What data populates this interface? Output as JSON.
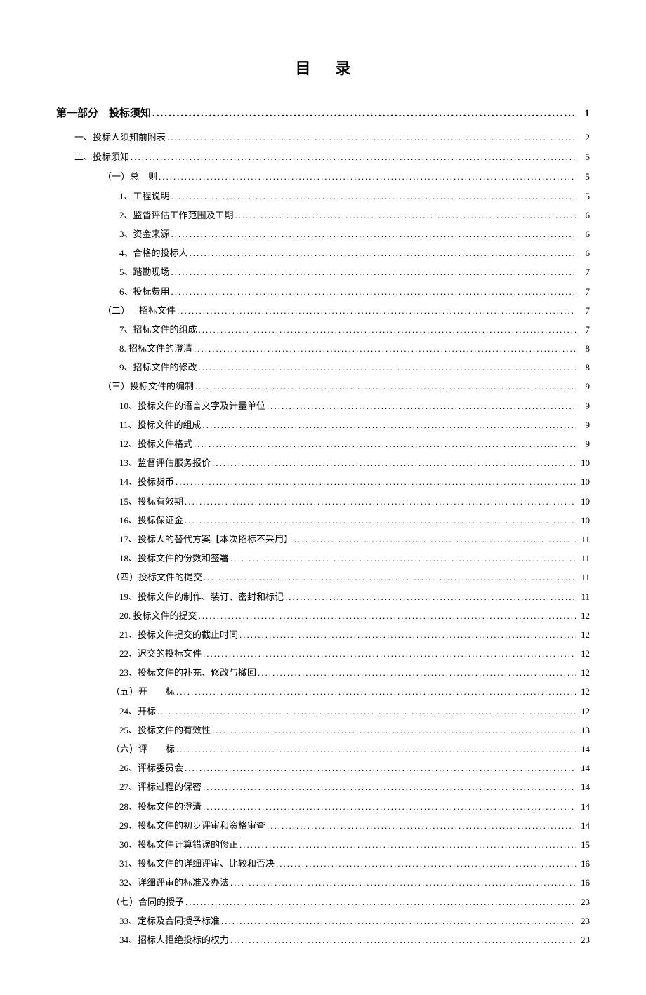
{
  "title": "目录",
  "entries": [
    {
      "level": 0,
      "label": "第一部分 投标须知",
      "page": "1"
    },
    {
      "level": 1,
      "label": "一、投标人须知前附表",
      "page": "2"
    },
    {
      "level": 1,
      "label": "二、投标须知",
      "page": "5"
    },
    {
      "level": 2,
      "label": "（一）总 则",
      "page": "5"
    },
    {
      "level": 3,
      "label": "1、工程说明",
      "page": "5"
    },
    {
      "level": 3,
      "label": "2、监督评估工作范围及工期",
      "page": "6"
    },
    {
      "level": 3,
      "label": "3、资金来源",
      "page": "6"
    },
    {
      "level": 3,
      "label": "4、合格的投标人",
      "page": "6"
    },
    {
      "level": 3,
      "label": "5、踏勘现场",
      "page": "7"
    },
    {
      "level": 3,
      "label": "6、投标费用",
      "page": "7"
    },
    {
      "level": 2,
      "label": "（二） 招标文件",
      "page": "7"
    },
    {
      "level": 3,
      "label": "7、招标文件的组成",
      "page": "7"
    },
    {
      "level": 3,
      "label": "8. 招标文件的澄清",
      "page": "8"
    },
    {
      "level": 3,
      "label": "9、招标文件的修改",
      "page": "8"
    },
    {
      "level": 2,
      "label": "（三）投标文件的编制",
      "page": "9"
    },
    {
      "level": 3,
      "label": "10、投标文件的语言文字及计量单位",
      "page": "9"
    },
    {
      "level": 3,
      "label": "11、投标文件的组成",
      "page": "9"
    },
    {
      "level": 3,
      "label": "12、投标文件格式",
      "page": "9"
    },
    {
      "level": 3,
      "label": "13、监督评估服务报价",
      "page": "10"
    },
    {
      "level": 3,
      "label": "14、投标货币",
      "page": "10"
    },
    {
      "level": 3,
      "label": "15、投标有效期",
      "page": "10"
    },
    {
      "level": 3,
      "label": "16、投标保证金",
      "page": "10"
    },
    {
      "level": 3,
      "label": "17、投标人的替代方案【本次招标不采用】",
      "page": "11"
    },
    {
      "level": 3,
      "label": "18、投标文件的份数和签署",
      "page": "11"
    },
    {
      "level": "3b",
      "label": "（四）投标文件的提交",
      "page": "11"
    },
    {
      "level": 3,
      "label": "19、投标文件的制作、装订、密封和标记",
      "page": "11"
    },
    {
      "level": 3,
      "label": "20. 投标文件的提交",
      "page": "12"
    },
    {
      "level": 3,
      "label": "21、投标文件提交的截止时间",
      "page": "12"
    },
    {
      "level": 3,
      "label": "22、迟交的投标文件",
      "page": "12"
    },
    {
      "level": 3,
      "label": "23、投标文件的补充、修改与撤回",
      "page": "12"
    },
    {
      "level": "3b",
      "label": "（五）开  标",
      "page": "12"
    },
    {
      "level": 3,
      "label": "24、开标",
      "page": "12"
    },
    {
      "level": 3,
      "label": "25、投标文件的有效性",
      "page": "13"
    },
    {
      "level": "3b",
      "label": "（六）评  标",
      "page": "14"
    },
    {
      "level": 3,
      "label": "26、评标委员会",
      "page": "14"
    },
    {
      "level": 3,
      "label": "27、评标过程的保密",
      "page": "14"
    },
    {
      "level": 3,
      "label": "28、投标文件的澄清",
      "page": "14"
    },
    {
      "level": 3,
      "label": "29、投标文件的初步评审和资格审查",
      "page": "14"
    },
    {
      "level": 3,
      "label": "30、投标文件计算错误的修正",
      "page": "15"
    },
    {
      "level": 3,
      "label": "31、投标文件的详细评审、比较和否决",
      "page": "16"
    },
    {
      "level": 3,
      "label": "32、详细评审的标准及办法",
      "page": "16"
    },
    {
      "level": "3b",
      "label": "（七）合同的授予",
      "page": "23"
    },
    {
      "level": 3,
      "label": "33、定标及合同授予标准",
      "page": "23"
    },
    {
      "level": 3,
      "label": "34、招标人拒绝投标的权力",
      "page": "23"
    }
  ]
}
